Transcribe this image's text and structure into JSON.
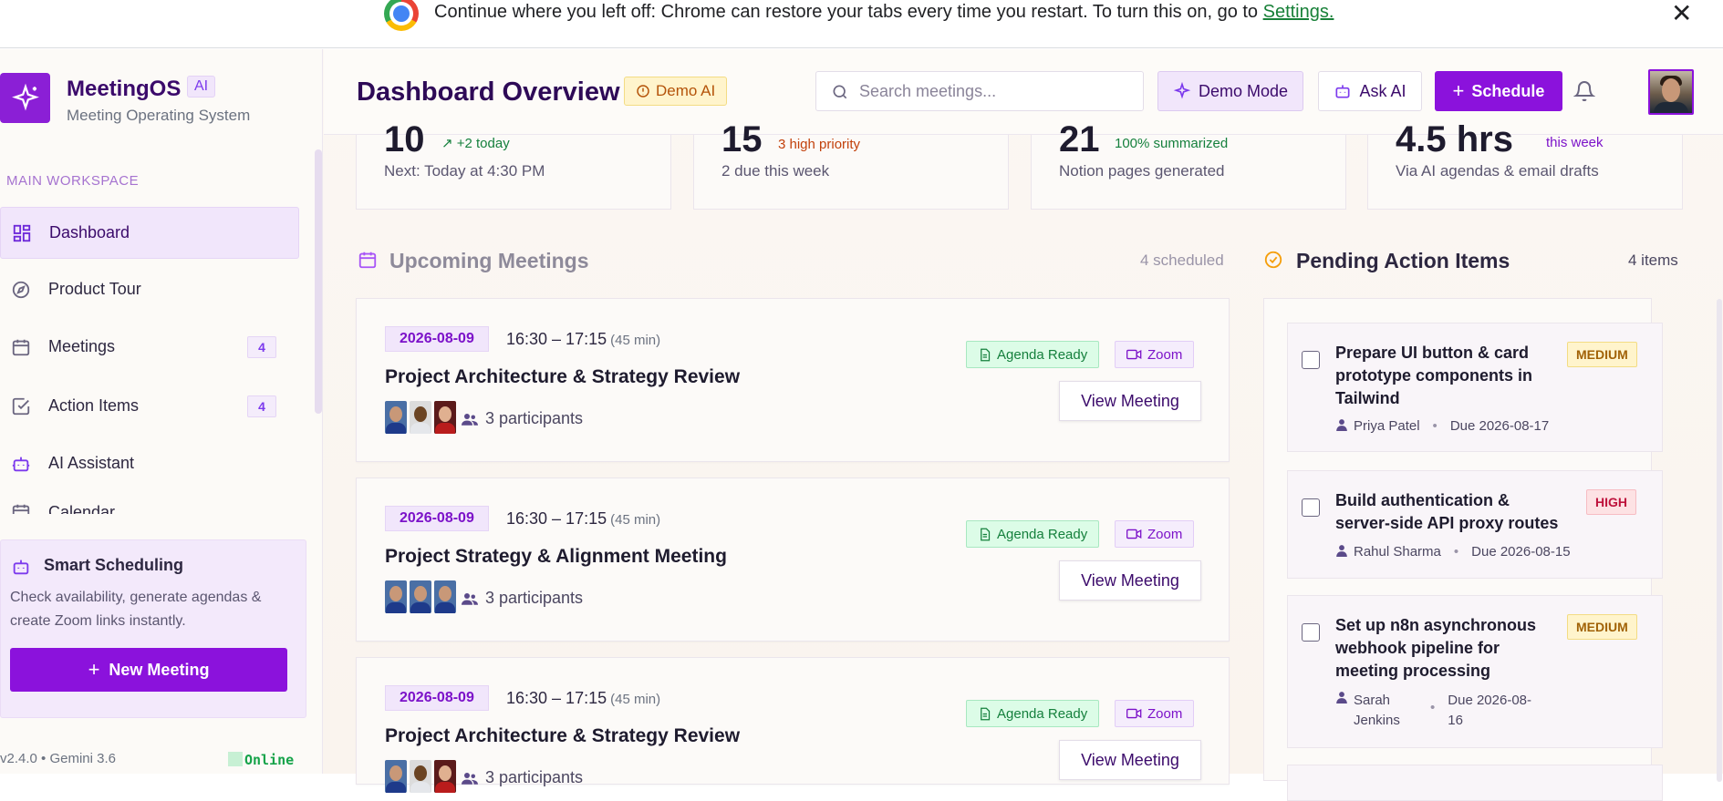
{
  "chrome_bar": {
    "message": "Continue where you left off: Chrome can restore your tabs every time you restart. To turn this on, go to ",
    "link": "Settings.",
    "close": "✕"
  },
  "sidebar": {
    "brand": "MeetingOS",
    "brand_badge": "AI",
    "brand_sub": "Meeting Operating System",
    "section_label": "MAIN WORKSPACE",
    "items": [
      {
        "label": "Dashboard",
        "icon": "grid-icon",
        "active": true
      },
      {
        "label": "Product Tour",
        "icon": "compass-icon"
      },
      {
        "label": "Meetings",
        "icon": "calendar-icon",
        "count": "4"
      },
      {
        "label": "Action Items",
        "icon": "checkbox-icon",
        "count": "4"
      },
      {
        "label": "AI Assistant",
        "icon": "bot-icon"
      },
      {
        "label": "Calendar",
        "icon": "calendar-icon"
      }
    ],
    "smart": {
      "title": "Smart Scheduling",
      "desc": "Check availability, generate agendas & create Zoom links instantly.",
      "button": "New Meeting"
    },
    "version": "v2.4.0 • Gemini 3.6",
    "status": "Online"
  },
  "header": {
    "title": "Dashboard Overview",
    "demo_chip": "Demo AI",
    "search_placeholder": "Search meetings...",
    "demo_mode": "Demo Mode",
    "ask_ai": "Ask AI",
    "schedule": "Schedule"
  },
  "stats": [
    {
      "value": "10",
      "delta": "↗ +2 today",
      "sub": "Next: Today at 4:30 PM"
    },
    {
      "value": "15",
      "delta": "3 high priority",
      "sub": "2 due this week"
    },
    {
      "value": "21",
      "delta": "100% summarized",
      "sub": "Notion pages generated"
    },
    {
      "value": "4.5 hrs",
      "delta": "this week",
      "sub": "Via AI agendas & email drafts"
    }
  ],
  "upcoming": {
    "title": "Upcoming Meetings",
    "count": "4 scheduled",
    "meetings": [
      {
        "date": "2026-08-09",
        "time": "16:30 – 17:15",
        "duration": "(45 min)",
        "title": "Project Architecture & Strategy Review",
        "participants": "3 participants",
        "agenda": "Agenda Ready",
        "zoom": "Zoom",
        "view": "View Meeting"
      },
      {
        "date": "2026-08-09",
        "time": "16:30 – 17:15",
        "duration": "(45 min)",
        "title": "Project Strategy & Alignment Meeting",
        "participants": "3 participants",
        "agenda": "Agenda Ready",
        "zoom": "Zoom",
        "view": "View Meeting"
      },
      {
        "date": "2026-08-09",
        "time": "16:30 – 17:15",
        "duration": "(45 min)",
        "title": "Project Architecture & Strategy Review",
        "participants": "3 participants",
        "agenda": "Agenda Ready",
        "zoom": "Zoom",
        "view": "View Meeting"
      }
    ]
  },
  "actions": {
    "title": "Pending Action Items",
    "count": "4 items",
    "items": [
      {
        "title": "Prepare UI button & card prototype components in Tailwind",
        "priority": "MEDIUM",
        "owner": "Priya Patel",
        "due": "Due 2026-08-17"
      },
      {
        "title": "Build authentication & server-side API proxy routes",
        "priority": "HIGH",
        "owner": "Rahul Sharma",
        "due": "Due 2026-08-15"
      },
      {
        "title": "Set up n8n asynchronous webhook pipeline for meeting processing",
        "priority": "MEDIUM",
        "owner": "Sarah Jenkins",
        "due": "Due 2026-08-16"
      }
    ]
  },
  "colors": {
    "brand": "#8b12dc",
    "agenda_green": "#15803d",
    "high_red": "#be123c",
    "medium_amber": "#a16207"
  }
}
